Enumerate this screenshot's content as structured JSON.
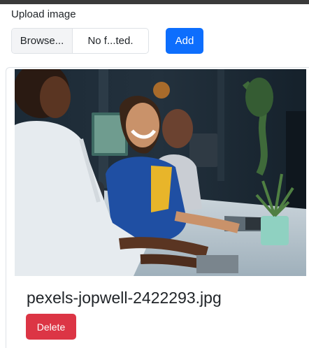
{
  "upload": {
    "label": "Upload image",
    "browse_label": "Browse...",
    "file_name": "No f...ted.",
    "add_label": "Add"
  },
  "gallery": {
    "items": [
      {
        "caption": "pexels-jopwell-2422293.jpg",
        "delete_label": "Delete"
      }
    ]
  },
  "colors": {
    "primary": "#0d6efd",
    "danger": "#dc3545"
  }
}
